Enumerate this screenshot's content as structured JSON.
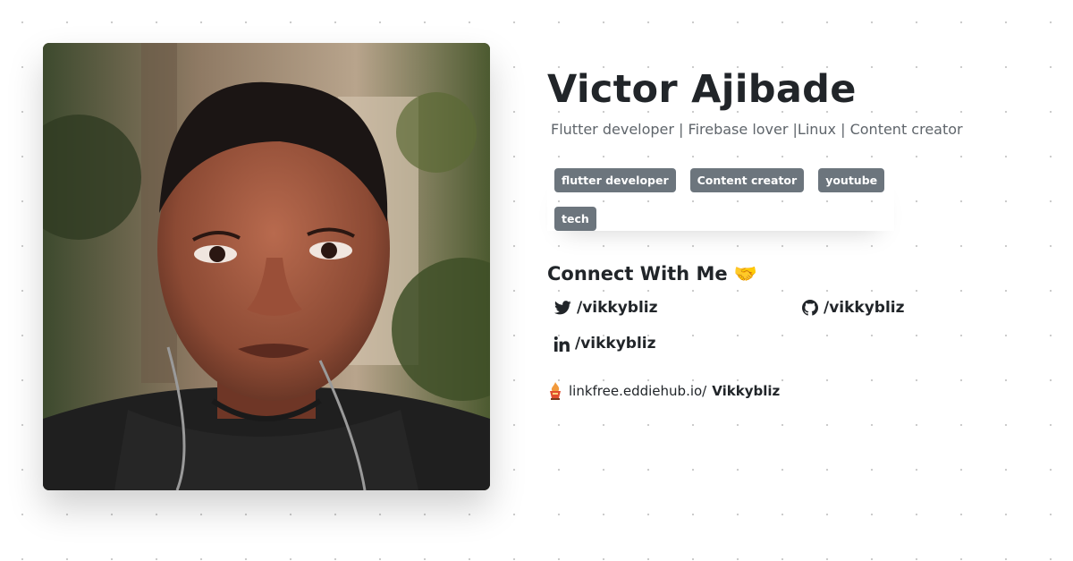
{
  "profile": {
    "name": "Victor Ajibade",
    "bio": "Flutter developer | Firebase lover |Linux | Content creator",
    "photo_icon": "profile-photo"
  },
  "tags": [
    {
      "label": "flutter developer"
    },
    {
      "label": "Content creator"
    },
    {
      "label": "youtube"
    },
    {
      "label": "tech"
    }
  ],
  "connect": {
    "heading": "Connect With Me",
    "heading_emoji": "🤝",
    "socials": [
      {
        "icon": "twitter-icon",
        "handle": "/vikkybliz"
      },
      {
        "icon": "github-icon",
        "handle": "/vikkybliz"
      },
      {
        "icon": "linkedin-icon",
        "handle": "/vikkybliz"
      }
    ]
  },
  "footer": {
    "icon": "linkfree-logo-icon",
    "domain": "linkfree.eddiehub.io/",
    "username": "Vikkybliz"
  },
  "colors": {
    "tag_background": "#6c757d",
    "text": "#212529",
    "muted_text": "#5f656b"
  }
}
